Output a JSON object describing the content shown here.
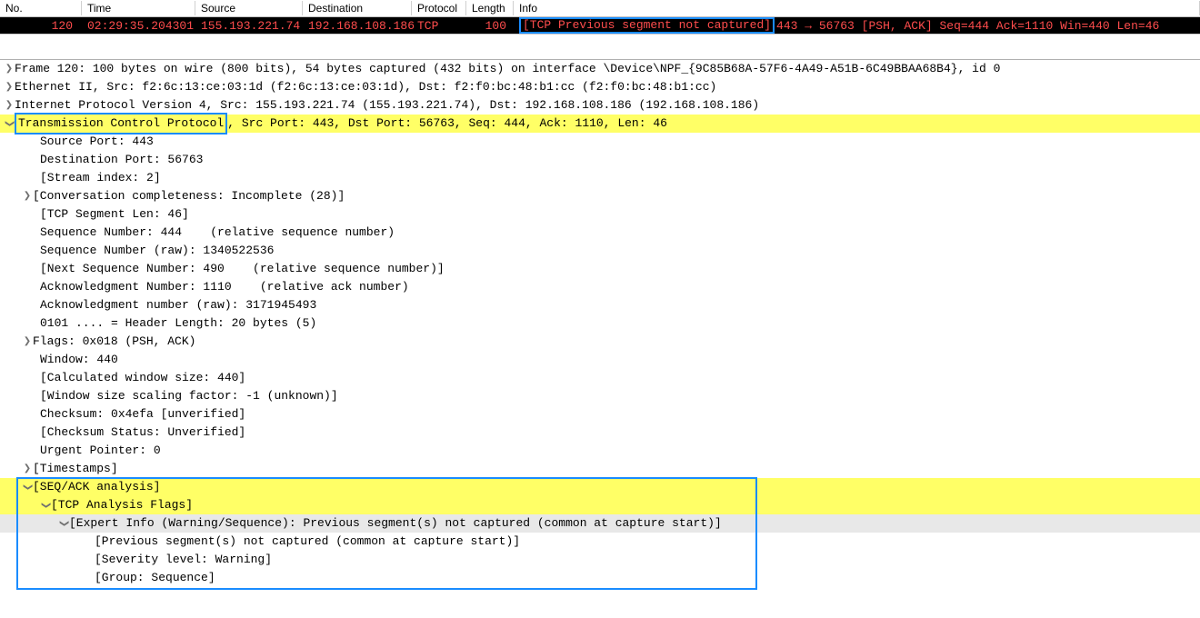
{
  "columns": {
    "no": "No.",
    "time": "Time",
    "source": "Source",
    "destination": "Destination",
    "protocol": "Protocol",
    "length": "Length",
    "info": "Info"
  },
  "packet": {
    "no": "120",
    "time": "02:29:35.204301",
    "source": "155.193.221.74",
    "destination": "192.168.108.186",
    "protocol": "TCP",
    "length": "100",
    "info_bracket": "[TCP Previous segment not captured]",
    "info_rest": " 443 → 56763 [PSH, ACK] Seq=444 Ack=1110 Win=440 Len=46"
  },
  "detail": {
    "frame": "Frame 120: 100 bytes on wire (800 bits), 54 bytes captured (432 bits) on interface \\Device\\NPF_{9C85B68A-57F6-4A49-A51B-6C49BBAA68B4}, id 0",
    "eth": "Ethernet II, Src: f2:6c:13:ce:03:1d (f2:6c:13:ce:03:1d), Dst: f2:f0:bc:48:b1:cc (f2:f0:bc:48:b1:cc)",
    "ip": "Internet Protocol Version 4, Src: 155.193.221.74 (155.193.221.74), Dst: 192.168.108.186 (192.168.108.186)",
    "tcp_label": "Transmission Control Protocol",
    "tcp_rest": ", Src Port: 443, Dst Port: 56763, Seq: 444, Ack: 1110, Len: 46",
    "src_port": "Source Port: 443",
    "dst_port": "Destination Port: 56763",
    "stream": "[Stream index: 2]",
    "conv": "[Conversation completeness: Incomplete (28)]",
    "seglen": "[TCP Segment Len: 46]",
    "seq": "Sequence Number: 444    (relative sequence number)",
    "seq_raw": "Sequence Number (raw): 1340522536",
    "next_seq": "[Next Sequence Number: 490    (relative sequence number)]",
    "ack": "Acknowledgment Number: 1110    (relative ack number)",
    "ack_raw": "Acknowledgment number (raw): 3171945493",
    "hdrlen": "0101 .... = Header Length: 20 bytes (5)",
    "flags": "Flags: 0x018 (PSH, ACK)",
    "window": "Window: 440",
    "calcwin": "[Calculated window size: 440]",
    "winscale": "[Window size scaling factor: -1 (unknown)]",
    "checksum": "Checksum: 0x4efa [unverified]",
    "chkstatus": "[Checksum Status: Unverified]",
    "urgent": "Urgent Pointer: 0",
    "timestamps": "[Timestamps]",
    "seqack": "[SEQ/ACK analysis]",
    "tcpflags": "[TCP Analysis Flags]",
    "expert": "[Expert Info (Warning/Sequence): Previous segment(s) not captured (common at capture start)]",
    "prev_seg": "[Previous segment(s) not captured (common at capture start)]",
    "severity": "[Severity level: Warning]",
    "group": "[Group: Sequence]"
  }
}
